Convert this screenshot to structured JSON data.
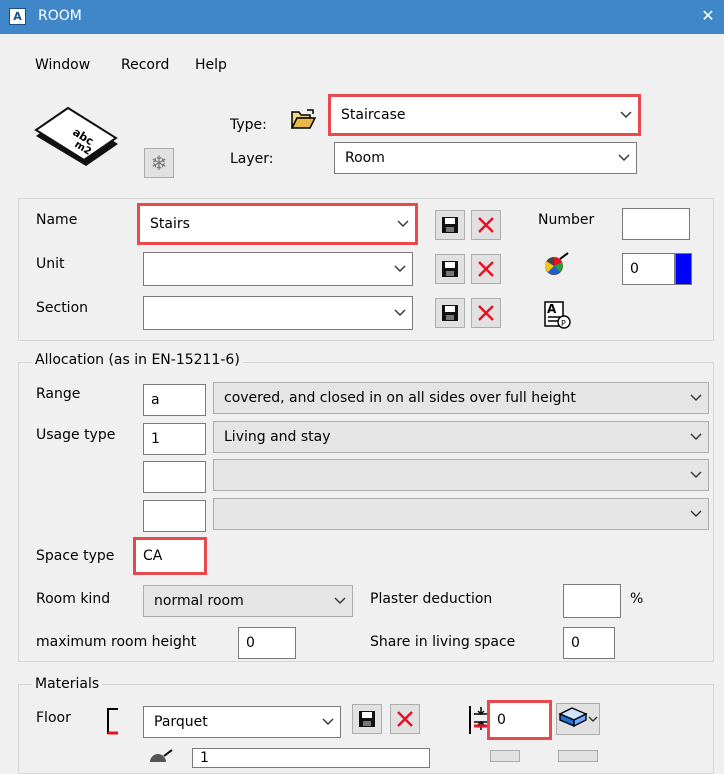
{
  "window": {
    "title": "ROOM",
    "app_icon": "A",
    "close_glyph": "✕"
  },
  "menu": [
    "Window",
    "Record",
    "Help"
  ],
  "header": {
    "type_label": "Type:",
    "type_value": "Staircase",
    "layer_label": "Layer:",
    "layer_value": "Room"
  },
  "identity": {
    "name_label": "Name",
    "name_value": "Stairs",
    "unit_label": "Unit",
    "unit_value": "",
    "section_label": "Section",
    "section_value": "",
    "number_label": "Number",
    "number_value": "",
    "color_index": "0",
    "color_swatch": "#0000ff"
  },
  "allocation": {
    "legend": "Allocation (as in EN-15211-6)",
    "range_label": "Range",
    "range_code": "a",
    "range_value": "covered, and closed in on all sides over full height",
    "usage_label": "Usage type",
    "usage_code": "1",
    "usage_value": "Living and stay",
    "extra1_code": "",
    "extra1_value": "",
    "extra2_code": "",
    "extra2_value": "",
    "space_type_label": "Space type",
    "space_type_value": "CA",
    "room_kind_label": "Room kind",
    "room_kind_value": "normal room",
    "plaster_label": "Plaster deduction",
    "plaster_value": "",
    "plaster_unit": "%",
    "max_height_label": "maximum room height",
    "max_height_value": "0",
    "share_label": "Share in living space",
    "share_value": "0"
  },
  "materials": {
    "legend": "Materials",
    "floor_label": "Floor",
    "floor_value": "Parquet",
    "floor_thickness": "0",
    "next_row_value": "1"
  },
  "colors": {
    "highlight": "#e8494d",
    "titlebar": "#3f87c9",
    "delete": "#e81123"
  }
}
